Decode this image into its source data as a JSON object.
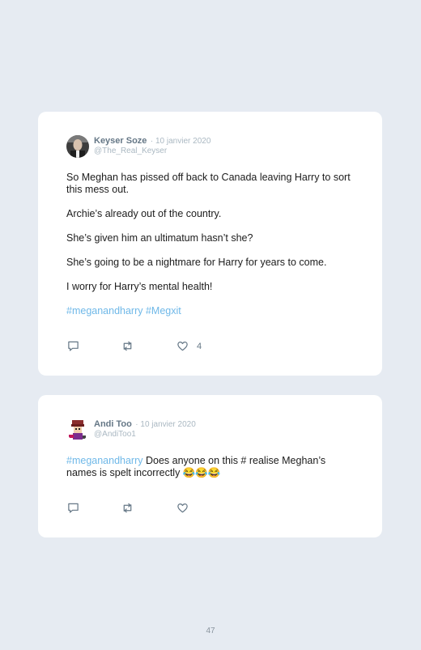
{
  "tweets": [
    {
      "name": "Keyser Soze",
      "date": "· 10 janvier 2020",
      "handle": "@The_Real_Keyser",
      "paragraphs": [
        "So Meghan has pissed off back to Canada leaving Harry to sort this mess out.",
        "Archie’s already out of the country.",
        "She’s given him an ultimatum hasn’t she?",
        "She’s going to be a nightmare for Harry for years to come.",
        "I worry for Harry’s mental health!"
      ],
      "hashtags": "#meganandharry #Megxit",
      "likes": "4"
    },
    {
      "name": "Andi Too",
      "date": "· 10 janvier 2020",
      "handle": "@AndiToo1",
      "hashtag": "#meganandharry",
      "text": " Does anyone on this # realise Meghan’s names is spelt incorrectly 😂😂😂"
    }
  ],
  "icons": {
    "reply": "reply-icon",
    "retweet": "retweet-icon",
    "like": "heart-icon"
  },
  "colors": {
    "hashtag": "#6fb8e8",
    "meta": "#aab8c2",
    "name": "#657786",
    "background": "#e6ebf2"
  },
  "page_number": "47"
}
